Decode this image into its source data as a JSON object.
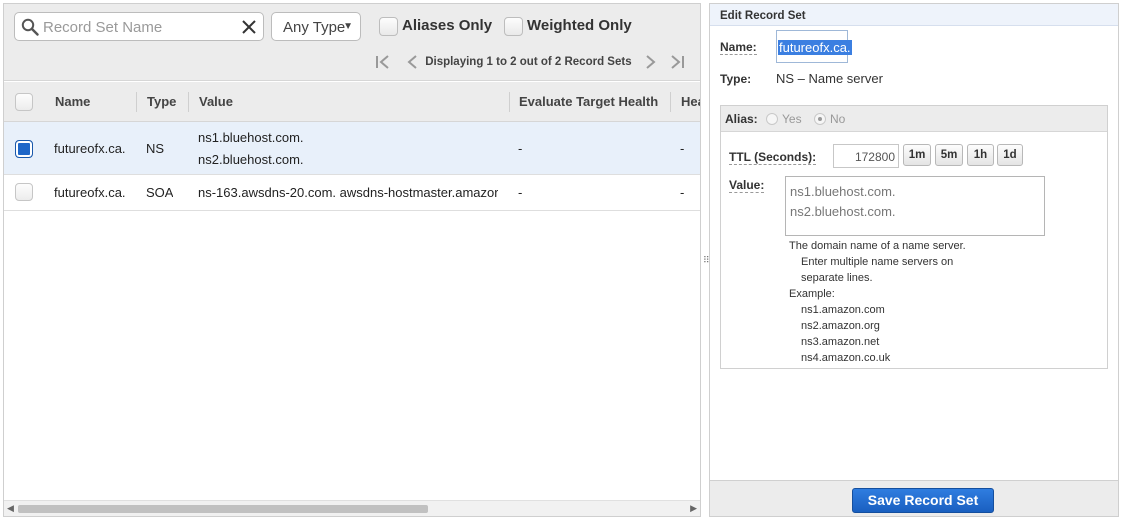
{
  "filters": {
    "search_placeholder": "Record Set Name",
    "type_select": "Any Type",
    "aliases_only": "Aliases Only",
    "weighted_only": "Weighted Only"
  },
  "pager": {
    "text": "Displaying 1 to 2 out of 2 Record Sets"
  },
  "table": {
    "headers": {
      "name": "Name",
      "type": "Type",
      "value": "Value",
      "evaluate": "Evaluate Target Health",
      "health": "Hea"
    },
    "rows": [
      {
        "name": "futureofx.ca.",
        "type": "NS",
        "value_lines": [
          "ns1.bluehost.com.",
          "ns2.bluehost.com."
        ],
        "evaluate": "-",
        "health": "-",
        "selected": true
      },
      {
        "name": "futureofx.ca.",
        "type": "SOA",
        "value_lines": [
          "ns-163.awsdns-20.com. awsdns-hostmaster.amazor"
        ],
        "evaluate": "-",
        "health": "-",
        "selected": false
      }
    ]
  },
  "splitter": {
    "glyph": "⠿"
  },
  "edit_panel": {
    "title": "Edit Record Set",
    "name_label": "Name:",
    "name_value": "futureofx.ca.",
    "type_label": "Type:",
    "type_value": "NS – Name server",
    "alias_label": "Alias:",
    "alias_yes": "Yes",
    "alias_no": "No",
    "ttl_label": "TTL (Seconds):",
    "ttl_value": "172800",
    "ttl_buttons": [
      "1m",
      "5m",
      "1h",
      "1d"
    ],
    "value_label": "Value:",
    "value_lines": [
      "ns1.bluehost.com.",
      "ns2.bluehost.com."
    ],
    "help": {
      "line1": "The domain name of a name server.",
      "line2": "Enter multiple name servers on",
      "line3": "separate lines.",
      "example_label": "Example:",
      "examples": [
        "ns1.amazon.com",
        "ns2.amazon.org",
        "ns3.amazon.net",
        "ns4.amazon.co.uk"
      ]
    },
    "save_label": "Save Record Set"
  },
  "colors": {
    "accent_blue": "#1f67c8",
    "selected_row": "#e8f0fa",
    "save_button": "#2a72d8"
  }
}
